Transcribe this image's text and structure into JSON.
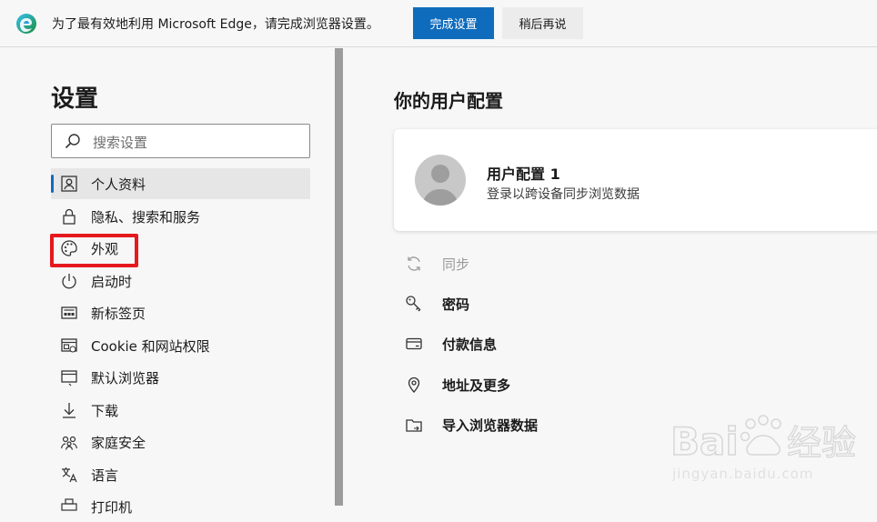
{
  "banner": {
    "message": "为了最有效地利用 Microsoft Edge，请完成浏览器设置。",
    "primary_button": "完成设置",
    "secondary_button": "稍后再说"
  },
  "sidebar": {
    "title": "设置",
    "search_placeholder": "搜索设置",
    "items": [
      {
        "label": "个人资料",
        "icon": "profile-icon",
        "active": true
      },
      {
        "label": "隐私、搜索和服务",
        "icon": "lock-icon"
      },
      {
        "label": "外观",
        "icon": "palette-icon",
        "highlighted": true
      },
      {
        "label": "启动时",
        "icon": "power-icon"
      },
      {
        "label": "新标签页",
        "icon": "new-tab-icon"
      },
      {
        "label": "Cookie 和网站权限",
        "icon": "site-permissions-icon"
      },
      {
        "label": "默认浏览器",
        "icon": "default-browser-icon"
      },
      {
        "label": "下载",
        "icon": "download-icon"
      },
      {
        "label": "家庭安全",
        "icon": "family-icon"
      },
      {
        "label": "语言",
        "icon": "language-icon"
      },
      {
        "label": "打印机",
        "icon": "printer-icon"
      }
    ]
  },
  "main": {
    "title": "你的用户配置",
    "profile": {
      "name": "用户配置 1",
      "subtitle": "登录以跨设备同步浏览数据"
    },
    "options": [
      {
        "label": "同步",
        "icon": "sync-icon",
        "disabled": true
      },
      {
        "label": "密码",
        "icon": "key-icon"
      },
      {
        "label": "付款信息",
        "icon": "card-icon"
      },
      {
        "label": "地址及更多",
        "icon": "location-icon"
      },
      {
        "label": "导入浏览器数据",
        "icon": "import-icon"
      }
    ]
  },
  "watermark": {
    "brand": "Bai du 经验",
    "url": "jingyan.baidu.com"
  },
  "colors": {
    "accent": "#0f6cbd",
    "highlight": "#e5191e",
    "background": "#f7f7f7"
  }
}
